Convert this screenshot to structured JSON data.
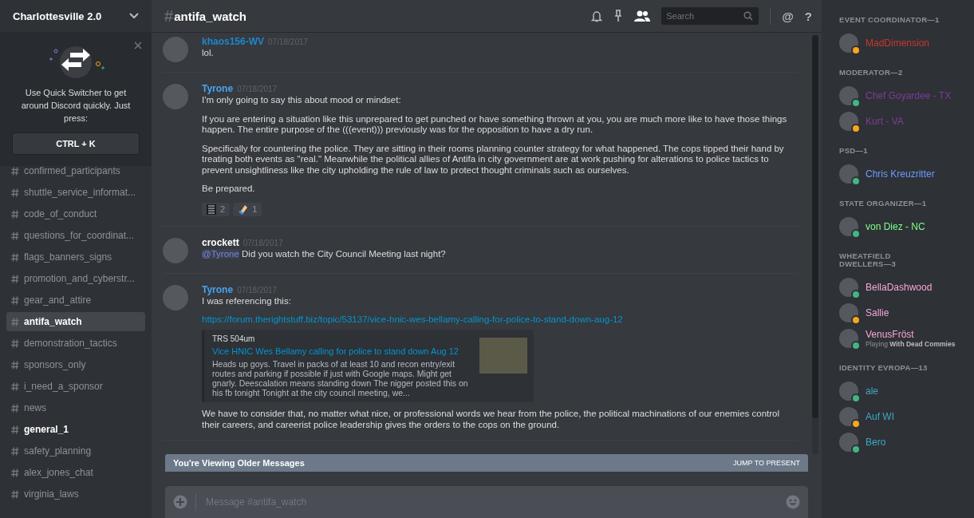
{
  "server": {
    "name": "Charlottesville 2.0"
  },
  "quick_switcher": {
    "text": "Use Quick Switcher to get around Discord quickly. Just press:",
    "shortcut": "CTRL + K"
  },
  "channels": [
    {
      "name": "confirmed_participants",
      "selected": false,
      "unread": false
    },
    {
      "name": "shuttle_service_informat...",
      "selected": false,
      "unread": false
    },
    {
      "name": "code_of_conduct",
      "selected": false,
      "unread": false
    },
    {
      "name": "questions_for_coordinat...",
      "selected": false,
      "unread": false
    },
    {
      "name": "flags_banners_signs",
      "selected": false,
      "unread": false
    },
    {
      "name": "promotion_and_cyberstr...",
      "selected": false,
      "unread": false
    },
    {
      "name": "gear_and_attire",
      "selected": false,
      "unread": false
    },
    {
      "name": "antifa_watch",
      "selected": true,
      "unread": false
    },
    {
      "name": "demonstration_tactics",
      "selected": false,
      "unread": false
    },
    {
      "name": "sponsors_only",
      "selected": false,
      "unread": false
    },
    {
      "name": "i_need_a_sponsor",
      "selected": false,
      "unread": false
    },
    {
      "name": "news",
      "selected": false,
      "unread": false
    },
    {
      "name": "general_1",
      "selected": false,
      "unread": true
    },
    {
      "name": "safety_planning",
      "selected": false,
      "unread": false
    },
    {
      "name": "alex_jones_chat",
      "selected": false,
      "unread": false
    },
    {
      "name": "virginia_laws",
      "selected": false,
      "unread": false
    }
  ],
  "header": {
    "hash": "#",
    "channel": "antifa_watch",
    "search_placeholder": "Search",
    "mention": "@",
    "help": "?"
  },
  "messages": [
    {
      "author": "khaos156-WV",
      "color": "#1e88c9",
      "time": "07/18/2017",
      "paragraphs": [
        "lol."
      ]
    },
    {
      "author": "Tyrone",
      "color": "#4aa3f0",
      "time": "07/18/2017",
      "paragraphs": [
        "I'm only going to say this about mood or mindset:",
        "If you are entering a situation like this unprepared to get punched or have something thrown at you, you are much more like to have those things happen. The entire purpose of the (((event))) previously was for the opposition to have a dry run.",
        "Specifically for countering the police. They are sitting in their rooms planning counter strategy for what happened. The cops tipped their hand by treating both events as \"real.\" Meanwhile the political allies of Antifa in city government are at work pushing for alterations to police tactics to prevent unsightliness like the city upholding the rule of law to protect thought criminals such as ourselves.",
        "Be prepared."
      ],
      "reactions": [
        {
          "kind": "text-emoji",
          "count": "2"
        },
        {
          "kind": "hand-emoji",
          "count": "1"
        }
      ]
    },
    {
      "author": "crockett",
      "color": "#ffffff",
      "time": "07/18/2017",
      "mention": "@Tyrone",
      "paragraphs": [
        "Did you watch the City Council Meeting last night?"
      ]
    },
    {
      "author": "Tyrone",
      "color": "#4aa3f0",
      "time": "07/18/2017",
      "paragraphs": [
        "I was referencing this:"
      ],
      "link": "https://forum.therightstuff.biz/topic/53137/vice-hnic-wes-bellamy-calling-for-police-to-stand-down-aug-12",
      "embed": {
        "provider": "TRS 504um",
        "title": "Vice HNIC Wes Bellamy calling for police to stand down Aug 12",
        "description": "Heads up goys. Travel in packs of at least 10 and recon entry/exit routes and parking if possible if just with Google maps. Might get gnarly. Deescalation means standing down The nigger posted this on his fb tonight Tonight at the city council meeting, we..."
      },
      "after": "We have to consider that, no matter what nice, or professional words we hear from the police, the political machinations of our enemies control their careers, and careerist police leadership gives the orders to the cops on the ground."
    }
  ],
  "older_banner": {
    "text": "You're Viewing Older Messages",
    "action": "JUMP TO PRESENT"
  },
  "composer": {
    "placeholder": "Message #antifa_watch"
  },
  "member_groups": [
    {
      "title": "EVENT COORDINATOR—1",
      "members": [
        {
          "name": "MadDimension",
          "color": "#c9372c",
          "idle": true
        }
      ]
    },
    {
      "title": "MODERATOR—2",
      "members": [
        {
          "name": "Chef Goyardee - TX",
          "color": "#7d3c98",
          "idle": false
        },
        {
          "name": "Kurt - VA",
          "color": "#7d3c98",
          "idle": true
        }
      ]
    },
    {
      "title": "PSD—1",
      "members": [
        {
          "name": "Chris Kreuzritter",
          "color": "#6e9bff",
          "idle": false
        }
      ]
    },
    {
      "title": "STATE ORGANIZER—1",
      "members": [
        {
          "name": "von Diez - NC",
          "color": "#7dff8c",
          "idle": false
        }
      ]
    },
    {
      "title": "WHEATFIELD DWELLERS—3",
      "members": [
        {
          "name": "BellaDashwood",
          "color": "#f7a6d8",
          "idle": false
        },
        {
          "name": "Sallie",
          "color": "#f7a6d8",
          "idle": true
        },
        {
          "name": "VenusFröst",
          "color": "#f7a6d8",
          "idle": false,
          "activity_verb": "Playing",
          "activity": "With Dead Commies"
        }
      ]
    },
    {
      "title": "IDENTITY EVROPA—13",
      "members": [
        {
          "name": "ale",
          "color": "#3ea8c4",
          "idle": false
        },
        {
          "name": "Auf WI",
          "color": "#3ea8c4",
          "idle": true
        },
        {
          "name": "Bero",
          "color": "#3ea8c4",
          "idle": false
        }
      ]
    }
  ]
}
